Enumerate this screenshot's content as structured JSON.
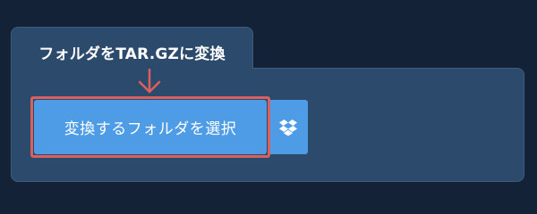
{
  "tab": {
    "title": "フォルダをTAR.GZに変換"
  },
  "actions": {
    "select_folder_label": "変換するフォルダを選択",
    "dropbox_icon": "dropbox-icon"
  },
  "annotation": {
    "arrow_icon": "arrow-down-icon",
    "highlight_color": "#d9605c"
  },
  "colors": {
    "background": "#132236",
    "panel": "#2c4a6c",
    "button": "#4e9be6",
    "accent": "#d9605c"
  }
}
